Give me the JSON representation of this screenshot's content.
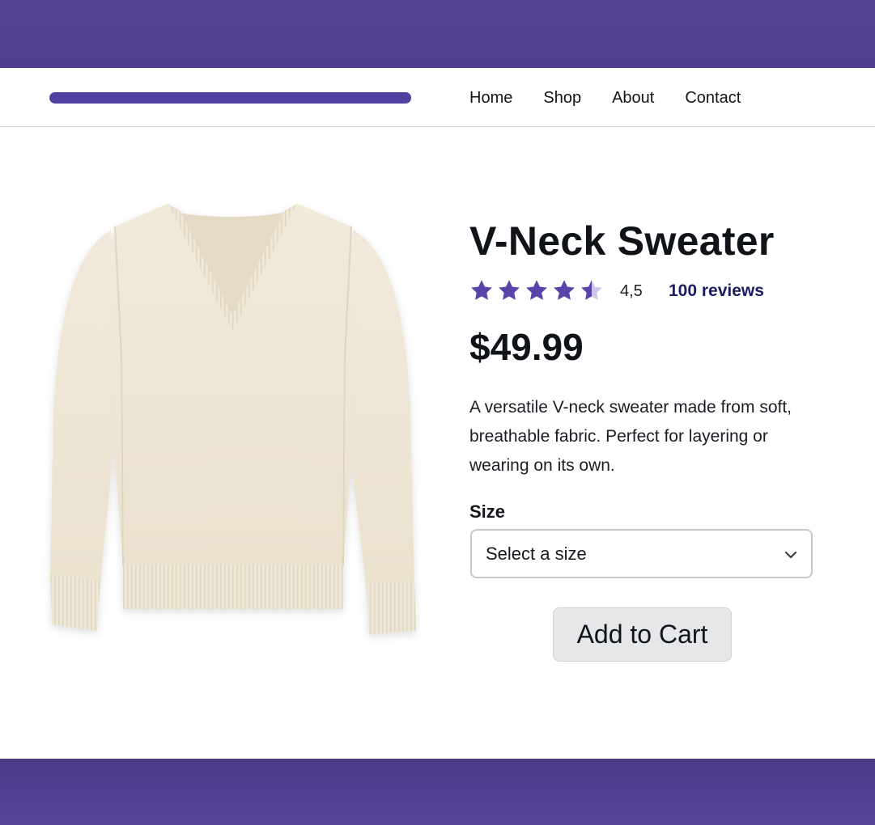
{
  "nav": {
    "links": [
      "Home",
      "Shop",
      "About",
      "Contact"
    ]
  },
  "product": {
    "title": "V-Neck Sweater",
    "rating": {
      "value_text": "4,5",
      "stars_filled": 4.5,
      "stars_total": 5,
      "reviews_label": "100 reviews"
    },
    "price": "$49.99",
    "description": "A versatile V-neck sweater made from soft, breathable fabric. Perfect for layering or wearing on its own.",
    "size_label": "Size",
    "size_select_placeholder": "Select a size",
    "add_to_cart_label": "Add to Cart",
    "image_icon": "sweater-image"
  },
  "colors": {
    "brand_purple": "#5140a0",
    "star": "#5a43a8",
    "star_empty": "#cdc5ec",
    "reviews_link": "#1d1a66",
    "button_bg": "#e6e7e9"
  }
}
